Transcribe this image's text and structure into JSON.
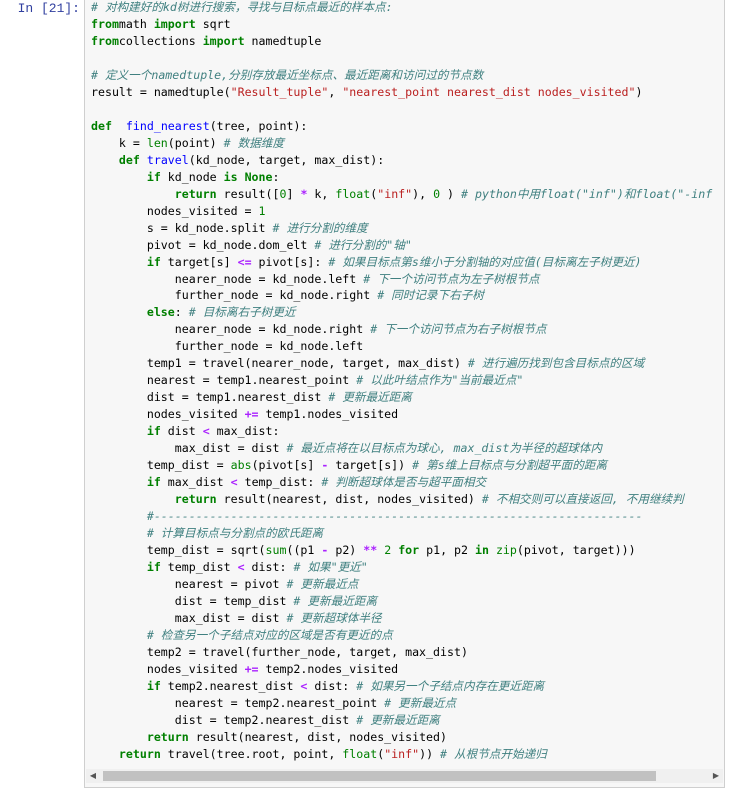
{
  "cell": {
    "prompt": "In  [21]:",
    "lines": [
      [
        [
          "cm",
          "# 对构建好的kd树进行搜索，寻找与目标点最近的样本点:"
        ]
      ],
      [
        [
          "kw",
          "from"
        ],
        [
          "",
          "math "
        ],
        [
          "kw",
          "import"
        ],
        [
          "",
          " sqrt"
        ]
      ],
      [
        [
          "kw",
          "from"
        ],
        [
          "",
          "collections "
        ],
        [
          "kw",
          "import"
        ],
        [
          "",
          " namedtuple"
        ]
      ],
      [],
      [
        [
          "cm",
          "# 定义一个namedtuple,分别存放最近坐标点、最近距离和访问过的节点数"
        ]
      ],
      [
        [
          "",
          "result = namedtuple("
        ],
        [
          "str",
          "\"Result_tuple\""
        ],
        [
          "",
          ", "
        ],
        [
          "str",
          "\"nearest_point nearest_dist nodes_visited\""
        ],
        [
          "",
          ")"
        ]
      ],
      [],
      [
        [
          "kw",
          "def"
        ],
        [
          "",
          "  "
        ],
        [
          "fn",
          "find_nearest"
        ],
        [
          "",
          "(tree, point):"
        ]
      ],
      [
        [
          "",
          "    k = "
        ],
        [
          "bi",
          "len"
        ],
        [
          "",
          "(point) "
        ],
        [
          "cm",
          "# 数据维度"
        ]
      ],
      [
        [
          "",
          "    "
        ],
        [
          "kw",
          "def"
        ],
        [
          "",
          " "
        ],
        [
          "fn",
          "travel"
        ],
        [
          "",
          "(kd_node, target, max_dist):"
        ]
      ],
      [
        [
          "",
          "        "
        ],
        [
          "kw",
          "if"
        ],
        [
          "",
          " kd_node "
        ],
        [
          "kw",
          "is None"
        ],
        [
          "",
          ":"
        ]
      ],
      [
        [
          "",
          "            "
        ],
        [
          "kw",
          "return"
        ],
        [
          "",
          " result(["
        ],
        [
          "num",
          "0"
        ],
        [
          "",
          "] "
        ],
        [
          "op",
          "*"
        ],
        [
          "",
          " k, "
        ],
        [
          "bi",
          "float"
        ],
        [
          "",
          "("
        ],
        [
          "str",
          "\"inf\""
        ],
        [
          "",
          "), "
        ],
        [
          "num",
          "0"
        ],
        [
          "",
          " ) "
        ],
        [
          "cm",
          "# python中用float(\"inf\")和float(\"-inf"
        ]
      ],
      [
        [
          "",
          "        nodes_visited = "
        ],
        [
          "num",
          "1"
        ]
      ],
      [
        [
          "",
          "        s = kd_node.split "
        ],
        [
          "cm",
          "# 进行分割的维度"
        ]
      ],
      [
        [
          "",
          "        pivot = kd_node.dom_elt "
        ],
        [
          "cm",
          "# 进行分割的\"轴\""
        ]
      ],
      [
        [
          "",
          "        "
        ],
        [
          "kw",
          "if"
        ],
        [
          "",
          " target[s] "
        ],
        [
          "op",
          "<="
        ],
        [
          "",
          " pivot[s]: "
        ],
        [
          "cm",
          "# 如果目标点第s维小于分割轴的对应值(目标离左子树更近)"
        ]
      ],
      [
        [
          "",
          "            nearer_node = kd_node.left "
        ],
        [
          "cm",
          "# 下一个访问节点为左子树根节点"
        ]
      ],
      [
        [
          "",
          "            further_node = kd_node.right "
        ],
        [
          "cm",
          "# 同时记录下右子树"
        ]
      ],
      [
        [
          "",
          "        "
        ],
        [
          "kw",
          "else"
        ],
        [
          "",
          ": "
        ],
        [
          "cm",
          "# 目标离右子树更近"
        ]
      ],
      [
        [
          "",
          "            nearer_node = kd_node.right "
        ],
        [
          "cm",
          "# 下一个访问节点为右子树根节点"
        ]
      ],
      [
        [
          "",
          "            further_node = kd_node.left"
        ]
      ],
      [
        [
          "",
          "        temp1 = travel(nearer_node, target, max_dist) "
        ],
        [
          "cm",
          "# 进行遍历找到包含目标点的区域"
        ]
      ],
      [
        [
          "",
          "        nearest = temp1.nearest_point "
        ],
        [
          "cm",
          "# 以此叶结点作为\"当前最近点\""
        ]
      ],
      [
        [
          "",
          "        dist = temp1.nearest_dist "
        ],
        [
          "cm",
          "# 更新最近距离"
        ]
      ],
      [
        [
          "",
          "        nodes_visited "
        ],
        [
          "op",
          "+="
        ],
        [
          "",
          " temp1.nodes_visited"
        ]
      ],
      [
        [
          "",
          "        "
        ],
        [
          "kw",
          "if"
        ],
        [
          "",
          " dist "
        ],
        [
          "op",
          "<"
        ],
        [
          "",
          " max_dist:"
        ]
      ],
      [
        [
          "",
          "            max_dist = dist "
        ],
        [
          "cm",
          "# 最近点将在以目标点为球心, max_dist为半径的超球体内"
        ]
      ],
      [
        [
          "",
          "        temp_dist = "
        ],
        [
          "bi",
          "abs"
        ],
        [
          "",
          "(pivot[s] "
        ],
        [
          "op",
          "-"
        ],
        [
          "",
          " target[s]) "
        ],
        [
          "cm",
          "# 第s维上目标点与分割超平面的距离"
        ]
      ],
      [
        [
          "",
          "        "
        ],
        [
          "kw",
          "if"
        ],
        [
          "",
          " max_dist "
        ],
        [
          "op",
          "<"
        ],
        [
          "",
          " temp_dist: "
        ],
        [
          "cm",
          "# 判断超球体是否与超平面相交"
        ]
      ],
      [
        [
          "",
          "            "
        ],
        [
          "kw",
          "return"
        ],
        [
          "",
          " result(nearest, dist, nodes_visited) "
        ],
        [
          "cm",
          "# 不相交则可以直接返回, 不用继续判"
        ]
      ],
      [
        [
          "",
          "        "
        ],
        [
          "cm",
          "#----------------------------------------------------------------------"
        ]
      ],
      [
        [
          "",
          "        "
        ],
        [
          "cm",
          "# 计算目标点与分割点的欧氏距离"
        ]
      ],
      [
        [
          "",
          "        temp_dist = sqrt("
        ],
        [
          "bi",
          "sum"
        ],
        [
          "",
          "((p1 "
        ],
        [
          "op",
          "-"
        ],
        [
          "",
          " p2) "
        ],
        [
          "op",
          "**"
        ],
        [
          "",
          " "
        ],
        [
          "num",
          "2"
        ],
        [
          "",
          " "
        ],
        [
          "kw",
          "for"
        ],
        [
          "",
          " p1, p2 "
        ],
        [
          "kw",
          "in"
        ],
        [
          "",
          " "
        ],
        [
          "bi",
          "zip"
        ],
        [
          "",
          "(pivot, target)))"
        ]
      ],
      [
        [
          "",
          "        "
        ],
        [
          "kw",
          "if"
        ],
        [
          "",
          " temp_dist "
        ],
        [
          "op",
          "<"
        ],
        [
          "",
          " dist: "
        ],
        [
          "cm",
          "# 如果\"更近\""
        ]
      ],
      [
        [
          "",
          "            nearest = pivot "
        ],
        [
          "cm",
          "# 更新最近点"
        ]
      ],
      [
        [
          "",
          "            dist = temp_dist "
        ],
        [
          "cm",
          "# 更新最近距离"
        ]
      ],
      [
        [
          "",
          "            max_dist = dist "
        ],
        [
          "cm",
          "# 更新超球体半径"
        ]
      ],
      [
        [
          "",
          "        "
        ],
        [
          "cm",
          "# 检查另一个子结点对应的区域是否有更近的点"
        ]
      ],
      [
        [
          "",
          "        temp2 = travel(further_node, target, max_dist)"
        ]
      ],
      [
        [
          "",
          "        nodes_visited "
        ],
        [
          "op",
          "+="
        ],
        [
          "",
          " temp2.nodes_visited"
        ]
      ],
      [
        [
          "",
          "        "
        ],
        [
          "kw",
          "if"
        ],
        [
          "",
          " temp2.nearest_dist "
        ],
        [
          "op",
          "<"
        ],
        [
          "",
          " dist: "
        ],
        [
          "cm",
          "# 如果另一个子结点内存在更近距离"
        ]
      ],
      [
        [
          "",
          "            nearest = temp2.nearest_point "
        ],
        [
          "cm",
          "# 更新最近点"
        ]
      ],
      [
        [
          "",
          "            dist = temp2.nearest_dist "
        ],
        [
          "cm",
          "# 更新最近距离"
        ]
      ],
      [
        [
          "",
          "        "
        ],
        [
          "kw",
          "return"
        ],
        [
          "",
          " result(nearest, dist, nodes_visited)"
        ]
      ],
      [
        [
          "",
          "    "
        ],
        [
          "kw",
          "return"
        ],
        [
          "",
          " travel(tree.root, point, "
        ],
        [
          "bi",
          "float"
        ],
        [
          "",
          "("
        ],
        [
          "str",
          "\"inf\""
        ],
        [
          "",
          ")) "
        ],
        [
          "cm",
          "# 从根节点开始递归"
        ]
      ]
    ]
  },
  "scrollbar": {
    "left_arrow": "◀",
    "right_arrow": "▶"
  }
}
